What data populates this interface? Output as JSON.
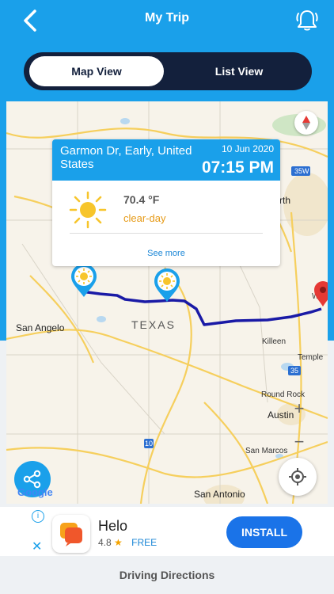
{
  "header": {
    "title": "My Trip",
    "back_icon": "chevron-left-icon",
    "bell_icon": "bell-ring-icon"
  },
  "tabs": [
    {
      "label": "Map View",
      "active": true
    },
    {
      "label": "List View",
      "active": false
    }
  ],
  "map": {
    "labels": {
      "texas": "TEXAS",
      "san_angelo": "San Angelo",
      "killeen": "Killeen",
      "temple": "Temple",
      "round_rock": "Round Rock",
      "austin": "Austin",
      "san_marcos": "San Marcos",
      "san_antonio": "San Antonio",
      "worth": "rth",
      "w": "W",
      "hwy_35w": "35W",
      "hwy_35": "35",
      "hwy_10": "10"
    },
    "google_logo": "Google",
    "route_color": "#1a1aa6"
  },
  "popup": {
    "place": "Garmon Dr, Early, United States",
    "date": "10 Jun 2020",
    "time": "07:15 PM",
    "temperature": "70.4 °F",
    "condition": "clear-day",
    "see_more": "See more",
    "weather_icon": "sun-icon"
  },
  "controls": {
    "zoom_in": "+",
    "zoom_out": "−"
  },
  "ad": {
    "info": "i",
    "close": "✕",
    "app_name": "Helo",
    "rating": "4.8",
    "star": "★",
    "price": "FREE",
    "install_label": "INSTALL"
  },
  "footer": {
    "label": "Driving Directions"
  },
  "colors": {
    "primary": "#1aa0ea",
    "segment_bg": "#13203c",
    "install": "#1a73e8",
    "weather_accent": "#e69a16"
  }
}
